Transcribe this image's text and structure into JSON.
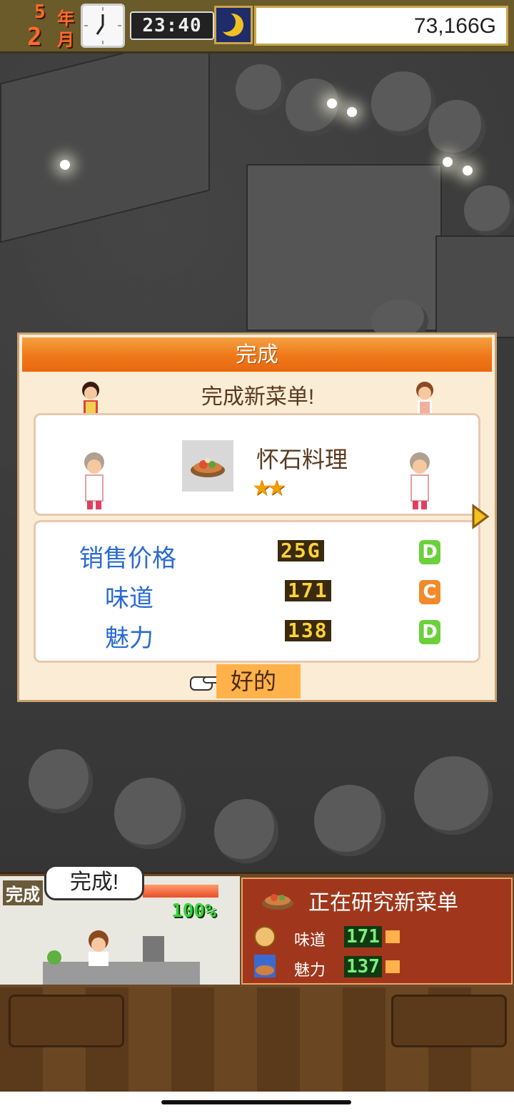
{
  "status": {
    "year_num": "5",
    "year_unit": "年",
    "month_num": "2",
    "month_unit": "月",
    "time": "23:40",
    "money": "73,166G"
  },
  "dialog": {
    "title": "完成",
    "subtitle": "完成新菜单!",
    "dish_name": "怀石料理",
    "stars": "★★",
    "ok_label": "好的",
    "stats": [
      {
        "label": "销售价格",
        "value": "25G",
        "grade": "D",
        "grade_color": "#6ad13a"
      },
      {
        "label": "味道",
        "value": "171",
        "grade": "C",
        "grade_color": "#f08a2a"
      },
      {
        "label": "魅力",
        "value": "138",
        "grade": "D",
        "grade_color": "#6ad13a"
      }
    ]
  },
  "kitchen": {
    "badge": "完成",
    "speech": "完成!",
    "progress": "100%"
  },
  "research": {
    "title": "正在研究新菜单",
    "rows": [
      {
        "label": "味道",
        "value": "171"
      },
      {
        "label": "魅力",
        "value": "137"
      }
    ]
  },
  "colors": {
    "title_orange": "#f07818",
    "stat_blue": "#2a6ad0",
    "research_red": "#a0371c"
  }
}
